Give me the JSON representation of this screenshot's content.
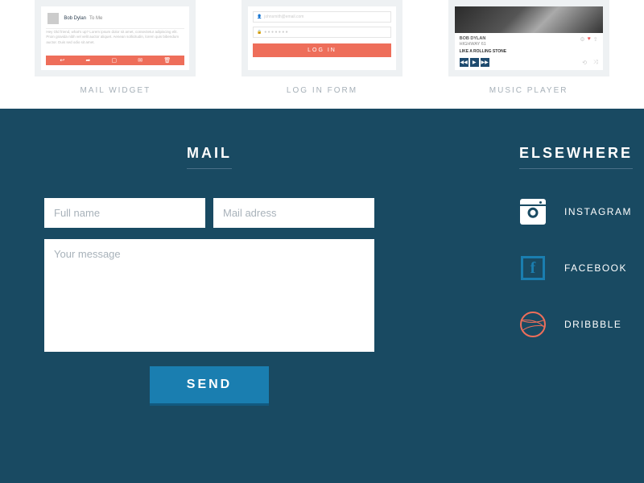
{
  "top": {
    "mail_widget": {
      "caption": "MAIL WIDGET",
      "from_label": "Bob Dylan",
      "to_label": "To Me",
      "body": "Hey Old friend, what's up? Lorem ipsum dolor sit amet, consectetur adipiscing elit. Proin gravida nibh vel velit auctor aliquet. Aenean sollicitudin, lorem quis bibendum auctor. Duis sed odio sit amet."
    },
    "login": {
      "caption": "LOG IN FORM",
      "email_placeholder": "johnsmith@email.com",
      "pass_placeholder": "● ● ● ● ● ● ●",
      "button": "LOG IN"
    },
    "music": {
      "caption": "MUSIC PLAYER",
      "artist": "BOB DYLAN",
      "album": "HIGHWAY 61",
      "song": "LIKE A ROLLING STONE"
    }
  },
  "footer": {
    "mail": {
      "title": "MAIL",
      "name_placeholder": "Full name",
      "email_placeholder": "Mail adress",
      "message_placeholder": "Your message",
      "send": "SEND"
    },
    "elsewhere": {
      "title": "ELSEWHERE",
      "instagram": "INSTAGRAM",
      "facebook": "FACEBOOK",
      "dribbble": "DRIBBBLE"
    }
  }
}
